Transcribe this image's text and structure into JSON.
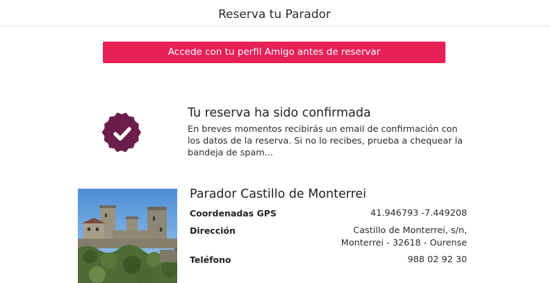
{
  "header": {
    "title": "Reserva tu Parador"
  },
  "login_button": {
    "label": "Accede con tu perfil Amigo antes de reservar"
  },
  "confirmation": {
    "title": "Tu reserva ha sido confirmada",
    "message": "En breves momentos recibirás un email de confirmación con los datos de la reserva. Si no lo recibes, prueba a chequear la bandeja de spam..."
  },
  "parador": {
    "name": "Parador Castillo de Monterrei",
    "gps_label": "Coordenadas GPS",
    "gps_value": "41.946793 -7.449208",
    "address_label": "Dirección",
    "address_line1": "Castillo de Monterrei, s/n,",
    "address_line2": "Monterrei - 32618 - Ourense",
    "phone_label": "Teléfono",
    "phone_value": "988 02 92 30"
  },
  "colors": {
    "accent": "#e8205a",
    "badge": "#6b1e4b"
  },
  "icons": {
    "badge": "check-badge-icon",
    "photo": "castle-photo"
  }
}
